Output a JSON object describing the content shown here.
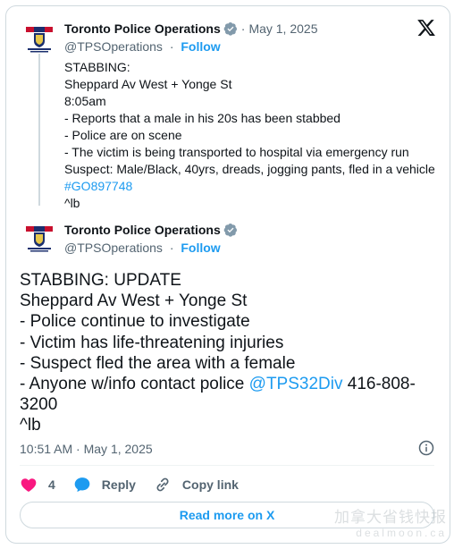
{
  "quoted_tweet": {
    "author_name": "Toronto Police Operations",
    "handle": "@TPSOperations",
    "follow_label": "Follow",
    "date": "May 1, 2025",
    "lines": [
      "STABBING:",
      "Sheppard Av West + Yonge St",
      "8:05am",
      "- Reports that a male in his 20s has been stabbed",
      "- Police are on scene",
      "- The victim is being transported to hospital via emergency run",
      "Suspect: Male/Black, 40yrs, dreads, jogging pants, fled in a vehicle"
    ],
    "hashtag": "#GO897748",
    "signoff": "^lb"
  },
  "main_tweet": {
    "author_name": "Toronto Police Operations",
    "handle": "@TPSOperations",
    "follow_label": "Follow",
    "lines": [
      "STABBING: UPDATE",
      "Sheppard Av West + Yonge St",
      "- Police continue to investigate",
      "- Victim has life-threatening injuries",
      "- Suspect fled the area with a female"
    ],
    "contact_prefix": "- Anyone w/info contact police ",
    "mention": "@TPS32Div",
    "contact_suffix": " 416-808-",
    "contact_line2": "3200",
    "signoff": "^lb",
    "timestamp": "10:51 AM",
    "date": "May 1, 2025"
  },
  "actions": {
    "like_count": "4",
    "reply_label": "Reply",
    "copy_link_label": "Copy link"
  },
  "read_more_label": "Read more on X",
  "watermark": {
    "line1": "加拿大省钱快报",
    "line2": "dealmoon.ca"
  },
  "colors": {
    "link": "#1d9bf0",
    "text": "#0f1419",
    "muted": "#536471",
    "like": "#f91880"
  },
  "icons": [
    "x-logo-icon",
    "verified-badge-icon",
    "police-crest-icon",
    "info-icon",
    "heart-icon",
    "reply-bubble-icon",
    "link-icon"
  ]
}
